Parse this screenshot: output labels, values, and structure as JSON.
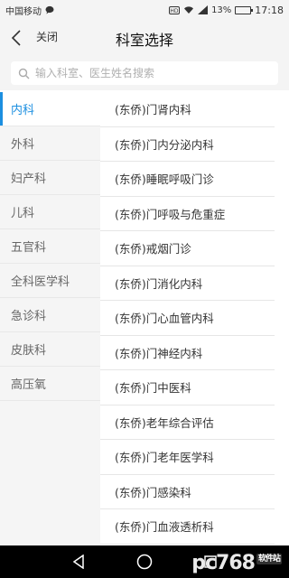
{
  "status_bar": {
    "carrier": "中国移动",
    "battery_text": "13%",
    "time": "17:18",
    "battery_level": 0.13,
    "icons": [
      "chat-icon",
      "hd-icon",
      "wifi-icon",
      "signal-icon",
      "battery-icon"
    ]
  },
  "header": {
    "back_icon": "chevron-left-icon",
    "close_label": "关闭",
    "title": "科室选择"
  },
  "search": {
    "icon": "search-icon",
    "placeholder": "输入科室、医生姓名搜索",
    "value": ""
  },
  "sidebar": {
    "active_color": "#1c8fe0",
    "items": [
      {
        "label": "内科",
        "active": true
      },
      {
        "label": "外科",
        "active": false
      },
      {
        "label": "妇产科",
        "active": false
      },
      {
        "label": "儿科",
        "active": false
      },
      {
        "label": "五官科",
        "active": false
      },
      {
        "label": "全科医学科",
        "active": false
      },
      {
        "label": "急诊科",
        "active": false
      },
      {
        "label": "皮肤科",
        "active": false
      },
      {
        "label": "高压氧",
        "active": false
      }
    ]
  },
  "departments": [
    "(东侨)门肾内科",
    "(东侨)门内分泌内科",
    "(东侨)睡眠呼吸门诊",
    "(东侨)门呼吸与危重症",
    "(东侨)戒烟门诊",
    "(东侨)门消化内科",
    "(东侨)门心血管内科",
    "(东侨)门神经内科",
    "(东侨)门中医科",
    "(东侨)老年综合评估",
    "(东侨)门老年医学科",
    "(东侨)门感染科",
    "(东侨)门血液透析科"
  ],
  "system_nav": {
    "icons": [
      "back-triangle-icon",
      "home-circle-icon",
      "recents-square-icon"
    ]
  },
  "watermark": {
    "text": "pc768",
    "badge": "软件站"
  }
}
